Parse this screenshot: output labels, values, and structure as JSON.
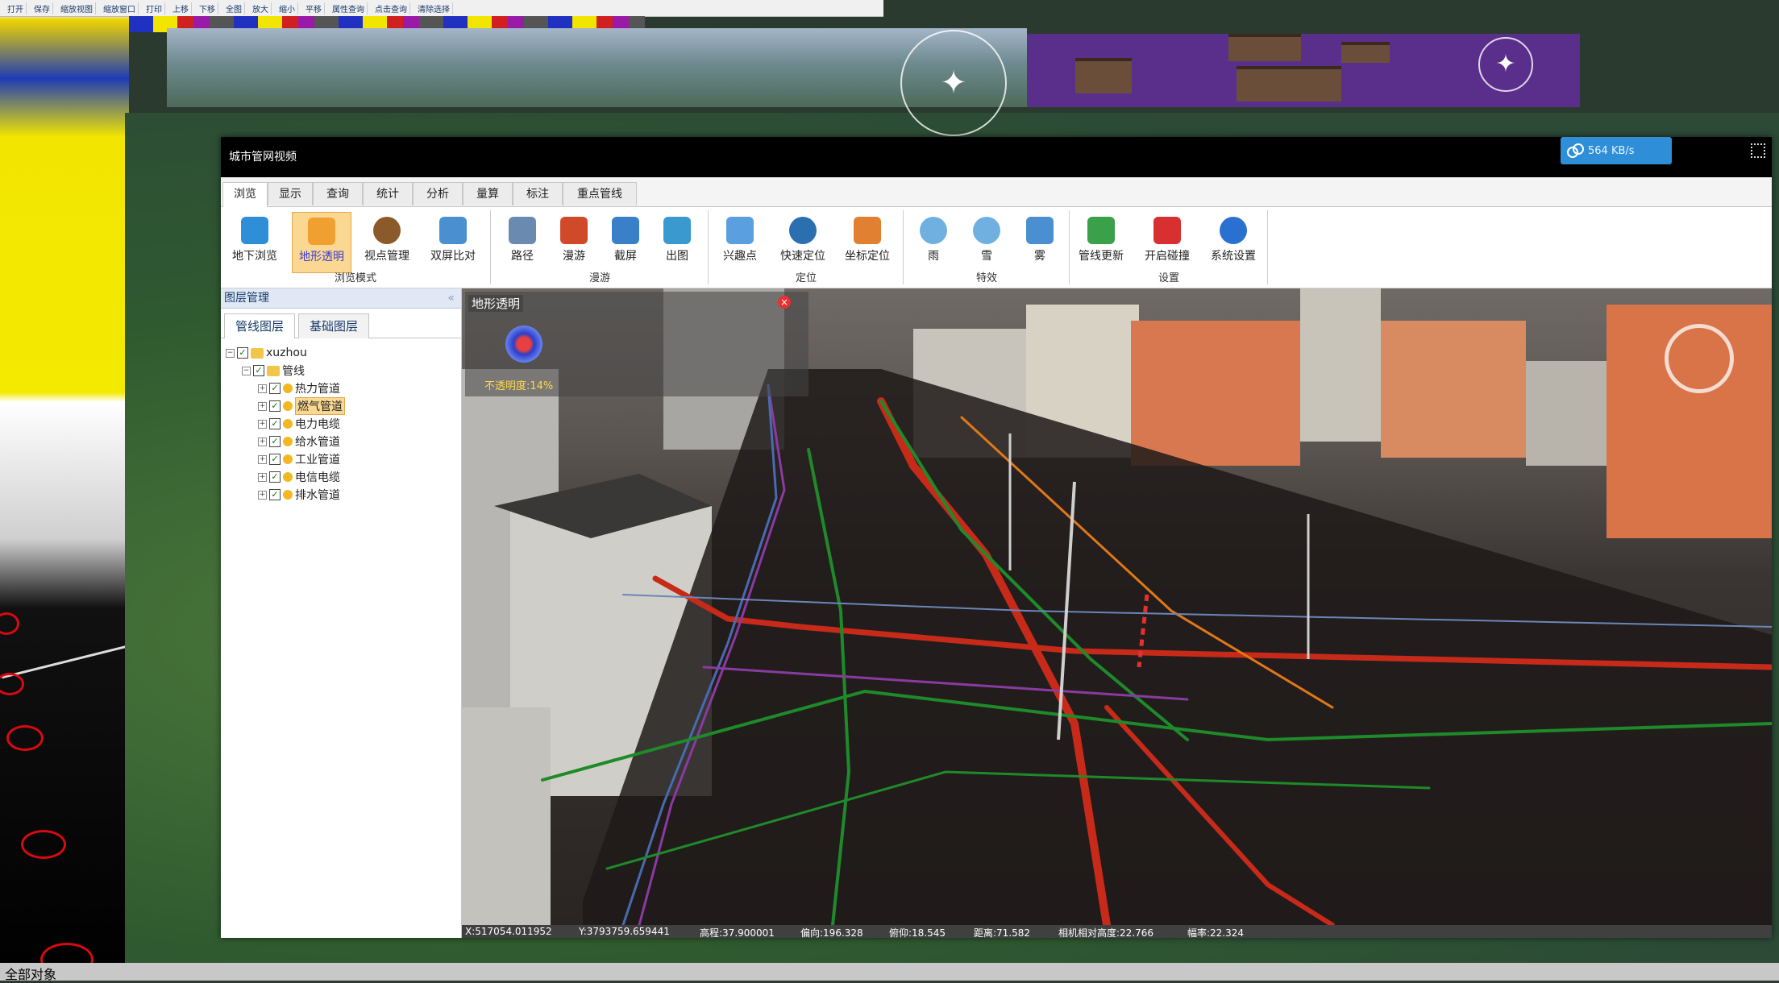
{
  "background": {
    "toolbar_items": [
      "打开",
      "保存",
      "缩放视图",
      "缩放窗口",
      "打印",
      "上移",
      "下移",
      "全图",
      "放大",
      "缩小",
      "平移",
      "属性查询",
      "点击查询",
      "清除选择"
    ],
    "bottom_text": "全部对象"
  },
  "app": {
    "title": "城市管网视频",
    "network_speed": "564 KB/s",
    "tabs": [
      "浏览",
      "显示",
      "查询",
      "统计",
      "分析",
      "量算",
      "标注",
      "重点管线"
    ],
    "ribbon_groups": [
      {
        "label": "浏览模式",
        "buttons": [
          {
            "label": "地下浏览",
            "icon": "underground-icon",
            "color": "#2e8fd8"
          },
          {
            "label": "地形透明",
            "icon": "terrain-transparent-icon",
            "color": "#f0a030",
            "active": true
          },
          {
            "label": "视点管理",
            "icon": "eye-icon",
            "color": "#8a5a2a"
          },
          {
            "label": "双屏比对",
            "icon": "split-screen-icon",
            "color": "#4a90d0"
          }
        ]
      },
      {
        "label": "漫游",
        "buttons": [
          {
            "label": "路径",
            "icon": "airplane-icon",
            "color": "#6a8ab0"
          },
          {
            "label": "漫游",
            "icon": "walk-icon",
            "color": "#d04a2a"
          },
          {
            "label": "截屏",
            "icon": "screenshot-icon",
            "color": "#3a80c8"
          },
          {
            "label": "出图",
            "icon": "export-map-icon",
            "color": "#3a9ad0"
          }
        ]
      },
      {
        "label": "定位",
        "buttons": [
          {
            "label": "兴趣点",
            "icon": "poi-icon",
            "color": "#5aa0e0"
          },
          {
            "label": "快速定位",
            "icon": "globe-icon",
            "color": "#2a70b0"
          },
          {
            "label": "坐标定位",
            "icon": "coordinate-icon",
            "color": "#e08030"
          }
        ]
      },
      {
        "label": "特效",
        "buttons": [
          {
            "label": "雨",
            "icon": "rain-icon",
            "color": "#70b0e0"
          },
          {
            "label": "雪",
            "icon": "snow-icon",
            "color": "#70b0e0"
          },
          {
            "label": "雾",
            "icon": "fog-icon",
            "color": "#4a90d0"
          }
        ]
      },
      {
        "label": "设置",
        "buttons": [
          {
            "label": "管线更新",
            "icon": "pipeline-update-icon",
            "color": "#3aa04a"
          },
          {
            "label": "开启碰撞",
            "icon": "collision-icon",
            "color": "#d83030"
          },
          {
            "label": "系统设置",
            "icon": "system-settings-icon",
            "color": "#2a70d0"
          }
        ]
      }
    ],
    "layer_panel": {
      "title": "图层管理",
      "tabs": [
        "管线图层",
        "基础图层"
      ],
      "tree": [
        {
          "label": "xuzhou",
          "level": 0,
          "type": "root"
        },
        {
          "label": "管线",
          "level": 1,
          "type": "folder"
        },
        {
          "label": "热力管道",
          "level": 2,
          "type": "layer"
        },
        {
          "label": "燃气管道",
          "level": 2,
          "type": "layer",
          "selected": true
        },
        {
          "label": "电力电缆",
          "level": 2,
          "type": "layer"
        },
        {
          "label": "给水管道",
          "level": 2,
          "type": "layer"
        },
        {
          "label": "工业管道",
          "level": 2,
          "type": "layer"
        },
        {
          "label": "电信电缆",
          "level": 2,
          "type": "layer"
        },
        {
          "label": "排水管道",
          "level": 2,
          "type": "layer"
        }
      ]
    },
    "opacity_dialog": {
      "title": "地形透明",
      "value_label": "不透明度:14%",
      "opacity_percent": 14
    },
    "status": {
      "x": "X:517054.011952",
      "y": "Y:3793759.659441",
      "elevation": "高程:37.900001",
      "heading": "偏向:196.328",
      "pitch": "俯仰:18.545",
      "distance": "距离:71.582",
      "camera_height": "相机相对高度:22.766",
      "rate": "幅率:22.324"
    }
  },
  "colors": {
    "pipe_red": "#c82a1a",
    "pipe_green": "#1e8a2a",
    "pipe_orange": "#e07818",
    "pipe_purple": "#8a3aa0",
    "pipe_blue": "#4a6ab0"
  }
}
